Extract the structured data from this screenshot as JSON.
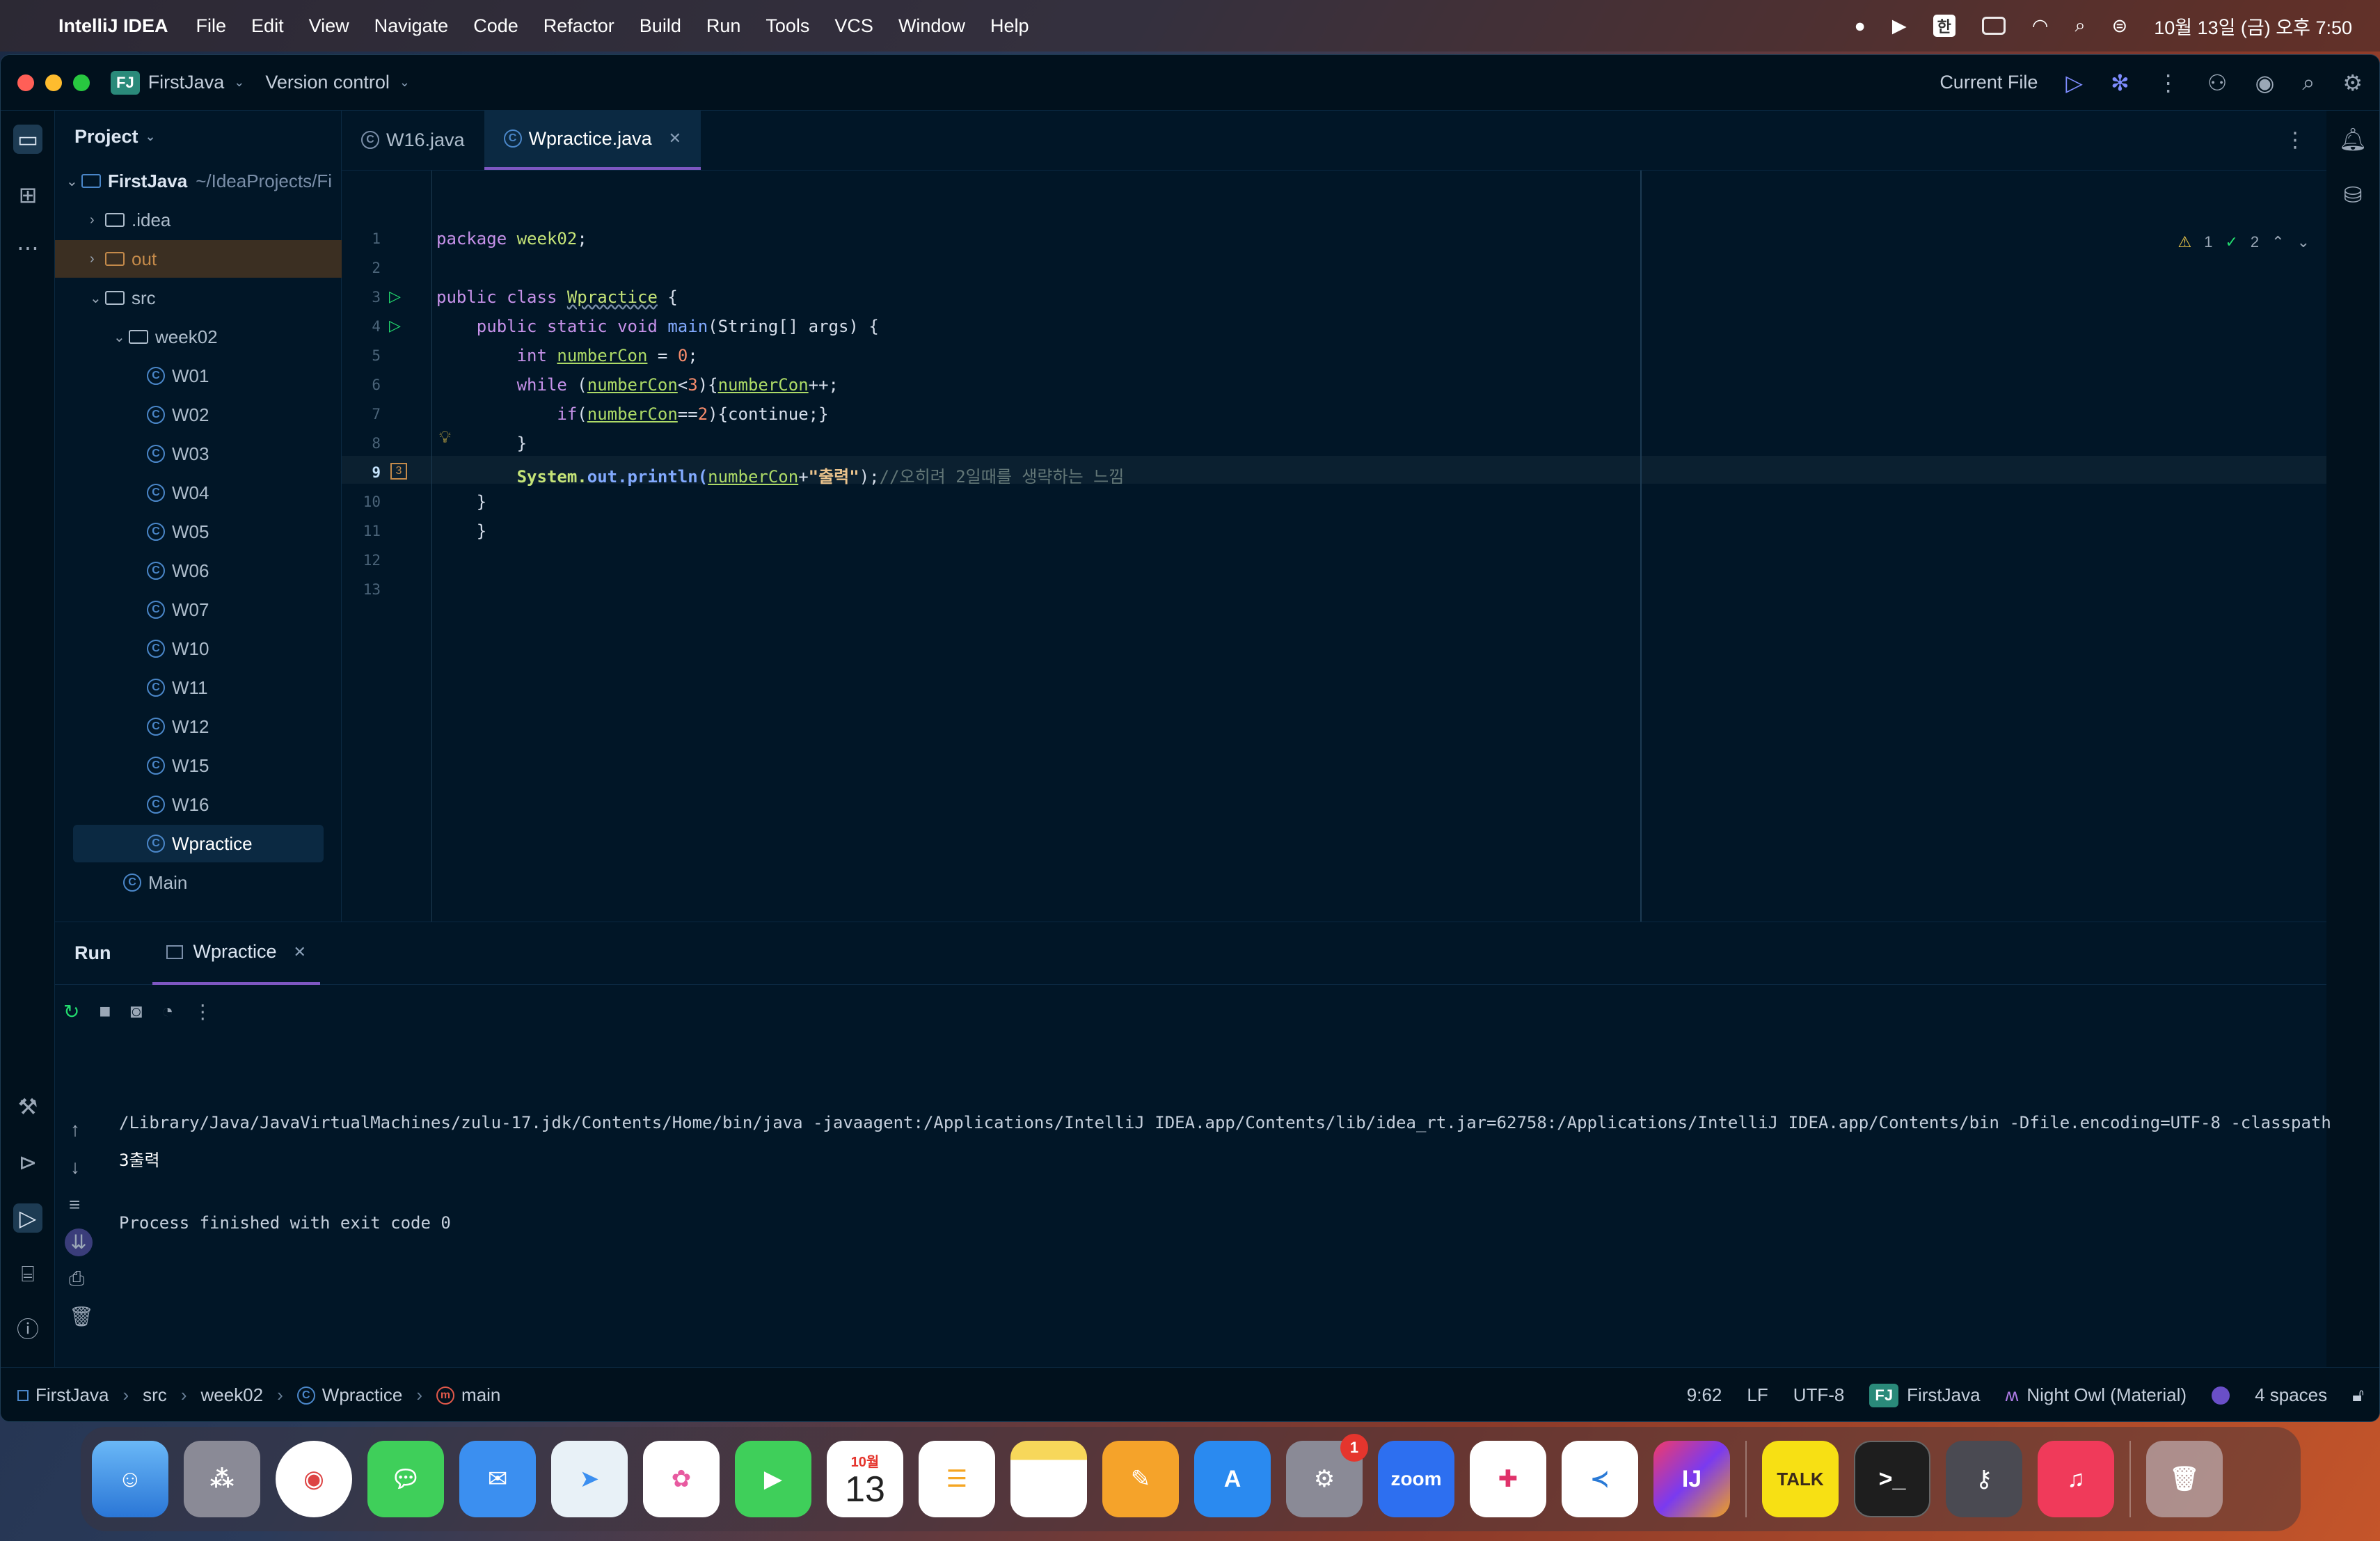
{
  "menubar": {
    "app_name": "IntelliJ IDEA",
    "items": [
      "File",
      "Edit",
      "View",
      "Navigate",
      "Code",
      "Refactor",
      "Build",
      "Run",
      "Tools",
      "VCS",
      "Window",
      "Help"
    ],
    "input_source": "한",
    "clock": "10월 13일 (금) 오후 7:50"
  },
  "titlebar": {
    "project_badge": "FJ",
    "project_name": "FirstJava",
    "vcs_label": "Version control",
    "run_config": "Current File"
  },
  "project_panel": {
    "title": "Project",
    "tree": [
      {
        "label": "FirstJava",
        "suffix": "~/IdeaProjects/Fi",
        "kind": "module",
        "depth": 0,
        "expanded": true
      },
      {
        "label": ".idea",
        "kind": "folder",
        "depth": 1,
        "expanded": false
      },
      {
        "label": "out",
        "kind": "folder-out",
        "depth": 1,
        "expanded": false
      },
      {
        "label": "src",
        "kind": "folder",
        "depth": 1,
        "expanded": true
      },
      {
        "label": "week02",
        "kind": "package",
        "depth": 2,
        "expanded": true
      },
      {
        "label": "W01",
        "kind": "class",
        "depth": 3
      },
      {
        "label": "W02",
        "kind": "class",
        "depth": 3
      },
      {
        "label": "W03",
        "kind": "class",
        "depth": 3
      },
      {
        "label": "W04",
        "kind": "class",
        "depth": 3
      },
      {
        "label": "W05",
        "kind": "class",
        "depth": 3
      },
      {
        "label": "W06",
        "kind": "class",
        "depth": 3
      },
      {
        "label": "W07",
        "kind": "class",
        "depth": 3
      },
      {
        "label": "W10",
        "kind": "class",
        "depth": 3
      },
      {
        "label": "W11",
        "kind": "class",
        "depth": 3
      },
      {
        "label": "W12",
        "kind": "class",
        "depth": 3
      },
      {
        "label": "W15",
        "kind": "class",
        "depth": 3
      },
      {
        "label": "W16",
        "kind": "class",
        "depth": 3
      },
      {
        "label": "Wpractice",
        "kind": "class",
        "depth": 3,
        "selected": true
      },
      {
        "label": "Main",
        "kind": "class",
        "depth": 2
      }
    ]
  },
  "editor": {
    "tabs": [
      {
        "label": "W16.java",
        "active": false
      },
      {
        "label": "Wpractice.java",
        "active": true
      }
    ],
    "inspections": {
      "warnings": "1",
      "checks": "2"
    },
    "current_line": "9",
    "line_numbers": [
      "1",
      "2",
      "3",
      "4",
      "5",
      "6",
      "7",
      "8",
      "9",
      "10",
      "11",
      "12",
      "13"
    ],
    "code": {
      "l1_kw": "package",
      "l1_pkg": "week02",
      "l1_end": ";",
      "l3_kw": "public class",
      "l3_name": "Wpractice",
      "l3_end": " {",
      "l4_kw": "public static void",
      "l4_m": "main",
      "l4_rest": "(String[] args) {",
      "l5_kw": "int",
      "l5_var": "numberCon",
      "l5_eq": " = ",
      "l5_num": "0",
      "l5_end": ";",
      "l6_kw": "while",
      "l6_a": " (",
      "l6_v1": "numberCon",
      "l6_b": "<",
      "l6_n": "3",
      "l6_c": "){",
      "l6_v2": "numberCon",
      "l6_d": "++;",
      "l7_kw": "if",
      "l7_a": "(",
      "l7_v": "numberCon",
      "l7_b": "==",
      "l7_n": "2",
      "l7_c": "){continue;}",
      "l8": "}",
      "l9_sys": "System.",
      "l9_out": "out",
      "l9_p": ".println(",
      "l9_v": "numberCon",
      "l9_plus": "+",
      "l9_str": "\"출력\"",
      "l9_end": ");",
      "l9_cmt": "//오히려 2일때를 생략하는 느낌",
      "l10": "}",
      "l11": "}"
    }
  },
  "run_panel": {
    "title": "Run",
    "tab_label": "Wpractice",
    "command": "/Library/Java/JavaVirtualMachines/zulu-17.jdk/Contents/Home/bin/java -javaagent:/Applications/IntelliJ IDEA.app/Contents/lib/idea_rt.jar=62758:/Applications/IntelliJ IDEA.app/Contents/bin -Dfile.encoding=UTF-8 -classpath",
    "output": "3출력",
    "exit": "Process finished with exit code 0"
  },
  "statusbar": {
    "breadcrumb": [
      "FirstJava",
      "src",
      "week02",
      "Wpractice",
      "main"
    ],
    "position": "9:62",
    "line_sep": "LF",
    "encoding": "UTF-8",
    "project_badge": "FJ",
    "project": "FirstJava",
    "theme": "Night Owl (Material)",
    "indent": "4 spaces"
  },
  "dock": {
    "calendar_month": "10월",
    "calendar_day": "13",
    "settings_badge": "1",
    "zoom": "zoom",
    "talk": "TALK",
    "ij": "IJ"
  },
  "colors": {
    "editor_bg": "#011627",
    "accent": "#7e57c2",
    "keyword": "#c792ea",
    "field": "#addb67",
    "string": "#ecc48d",
    "comment": "#637777"
  }
}
